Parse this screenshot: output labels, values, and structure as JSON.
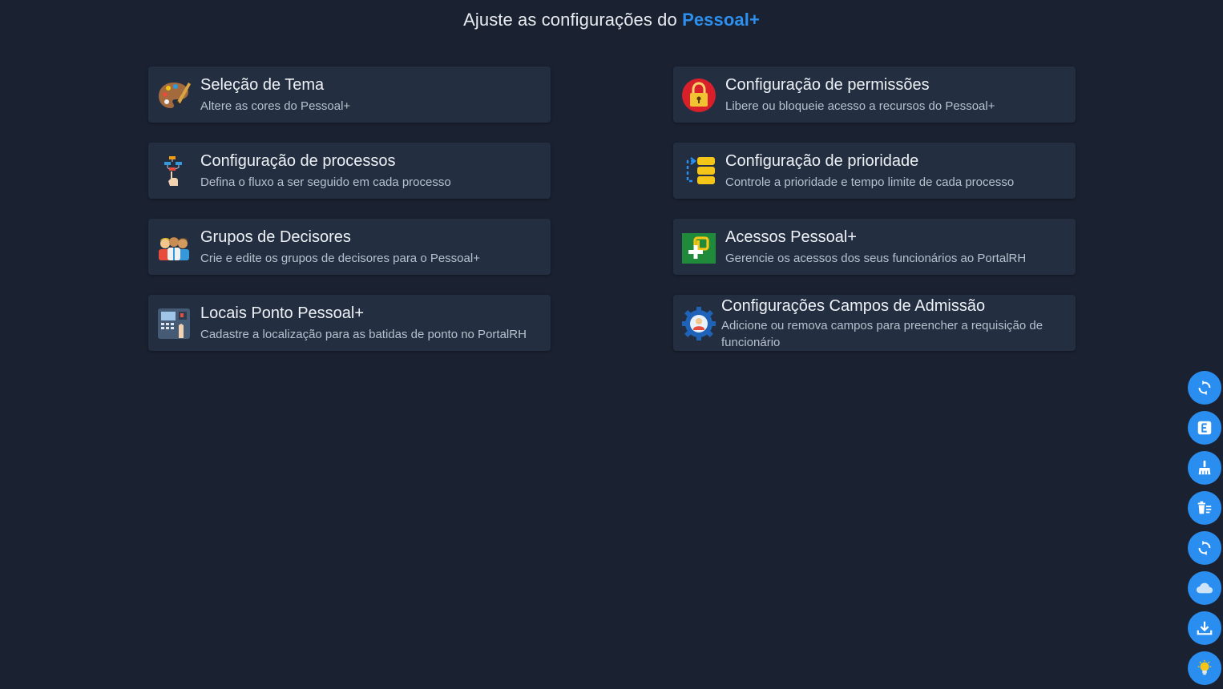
{
  "header": {
    "title_prefix": "Ajuste as configurações do",
    "title_brand": "Pessoal+"
  },
  "cards": [
    {
      "title": "Seleção de Tema",
      "description": "Altere as cores do Pessoal+",
      "icon": "palette-icon"
    },
    {
      "title": "Configuração de permissões",
      "description": "Libere ou bloqueie acesso a recursos do Pessoal+",
      "icon": "lock-icon"
    },
    {
      "title": "Configuração de processos",
      "description": "Defina o fluxo a ser seguido em cada processo",
      "icon": "flow-hand-icon"
    },
    {
      "title": "Configuração de prioridade",
      "description": "Controle a prioridade e tempo limite de cada processo",
      "icon": "priority-stack-icon"
    },
    {
      "title": "Grupos de Decisores",
      "description": "Crie e edite os grupos de decisores para o Pessoal+",
      "icon": "people-group-icon"
    },
    {
      "title": "Acessos Pessoal+",
      "description": "Gerencie os acessos dos seus funcionários ao PortalRH",
      "icon": "pessoal-access-icon"
    },
    {
      "title": "Locais Ponto Pessoal+",
      "description": "Cadastre a localização para as batidas de ponto no PortalRH",
      "icon": "time-clock-icon"
    },
    {
      "title": "Configurações Campos de Admissão",
      "description": "Adicione ou remova campos para preencher a requisição de funcionário",
      "icon": "user-gear-icon"
    }
  ],
  "side_actions": [
    {
      "name": "refresh-icon"
    },
    {
      "name": "e-badge-icon"
    },
    {
      "name": "broom-icon"
    },
    {
      "name": "trash-list-icon"
    },
    {
      "name": "sync-icon"
    },
    {
      "name": "cloud-icon"
    },
    {
      "name": "download-icon"
    },
    {
      "name": "lightbulb-icon"
    }
  ],
  "colors": {
    "background": "#1a2130",
    "card": "#232f41",
    "accent": "#2a8ef0",
    "brand": "#2d8fee"
  }
}
